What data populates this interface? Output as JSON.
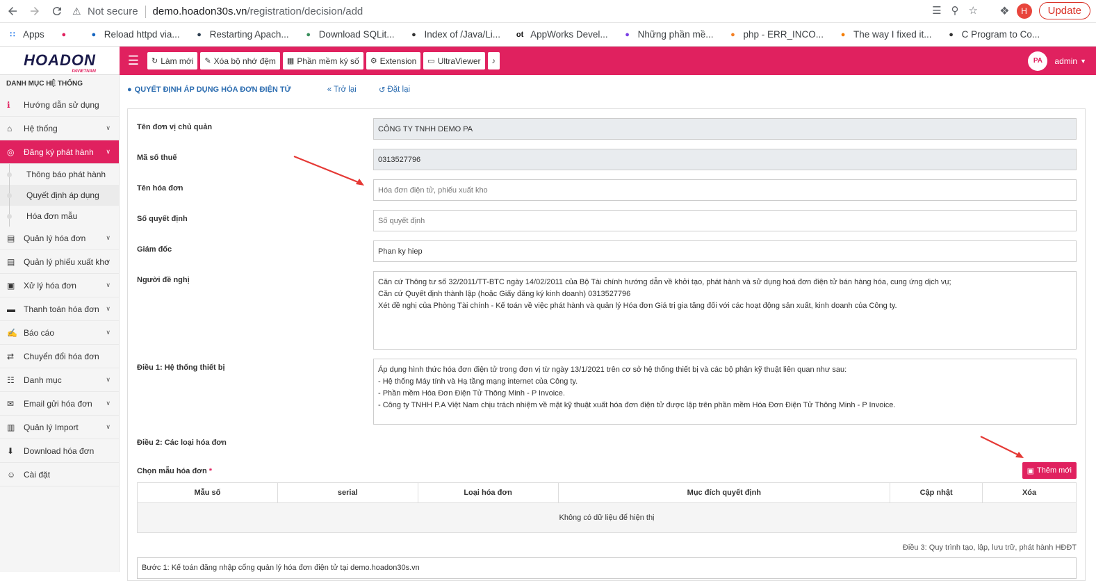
{
  "browser": {
    "not_secure": "Not secure",
    "url_domain": "demo.hoadon30s.vn",
    "url_path": "/registration/decision/add",
    "profile_initial": "H",
    "update_label": "Update"
  },
  "bookmarks": [
    {
      "label": "Apps",
      "icon": "apps-grid-icon",
      "color": "#1a73e8"
    },
    {
      "label": "",
      "icon": "helicopter-icon",
      "color": "#e0215f"
    },
    {
      "label": "Reload httpd via...",
      "icon": "person-icon",
      "color": "#1565c0"
    },
    {
      "label": "Restarting Apach...",
      "icon": "site-icon",
      "color": "#2c3e50"
    },
    {
      "label": "Download SQLit...",
      "icon": "sqlite-icon",
      "color": "#3a8f5c"
    },
    {
      "label": "Index of /Java/Li...",
      "icon": "globe-icon",
      "color": "#333"
    },
    {
      "label": "AppWorks Devel...",
      "icon": "ot-icon",
      "color": "#111"
    },
    {
      "label": "Những phần mề...",
      "icon": "note-icon",
      "color": "#7b3fe4"
    },
    {
      "label": "php - ERR_INCO...",
      "icon": "stackoverflow-icon",
      "color": "#f48024"
    },
    {
      "label": "The way I fixed it...",
      "icon": "blogger-icon",
      "color": "#f57d00"
    },
    {
      "label": "C Program to Co...",
      "icon": "circle-icon",
      "color": "#333"
    }
  ],
  "header": {
    "logo": "HOADON",
    "logo_sub": "PAVIETNAM",
    "buttons": [
      {
        "label": "Làm mới",
        "icon": "refresh-icon"
      },
      {
        "label": "Xóa bộ nhớ đệm",
        "icon": "brush-icon"
      },
      {
        "label": "Phần mềm ký số",
        "icon": "grid-icon"
      },
      {
        "label": "Extension",
        "icon": "extension-icon"
      },
      {
        "label": "UltraViewer",
        "icon": "monitor-icon"
      },
      {
        "label": "",
        "icon": "bell-icon"
      }
    ],
    "user": "admin"
  },
  "sidebar": {
    "title": "DANH MỤC HỆ THỐNG",
    "items": [
      {
        "label": "Hướng dẫn sử dụng",
        "icon": "info-icon",
        "chevron": false
      },
      {
        "label": "Hệ thống",
        "icon": "home-icon",
        "chevron": true
      },
      {
        "label": "Đăng ký phát hành",
        "icon": "globe-icon",
        "chevron": true,
        "active": true
      },
      {
        "label": "Quản lý hóa đơn",
        "icon": "file-icon",
        "chevron": true
      },
      {
        "label": "Quản lý phiếu xuất kho",
        "icon": "file-icon",
        "chevron": true
      },
      {
        "label": "Xử lý hóa đơn",
        "icon": "save-icon",
        "chevron": true
      },
      {
        "label": "Thanh toán hóa đơn",
        "icon": "card-icon",
        "chevron": true
      },
      {
        "label": "Báo cáo",
        "icon": "edit-icon",
        "chevron": true
      },
      {
        "label": "Chuyển đổi hóa đơn",
        "icon": "exchange-icon",
        "chevron": false
      },
      {
        "label": "Danh mục",
        "icon": "sitemap-icon",
        "chevron": true
      },
      {
        "label": "Email gửi hóa đơn",
        "icon": "envelope-icon",
        "chevron": true
      },
      {
        "label": "Quản lý Import",
        "icon": "archive-icon",
        "chevron": true
      },
      {
        "label": "Download hóa đơn",
        "icon": "download-icon",
        "chevron": false
      },
      {
        "label": "Cài đặt",
        "icon": "user-cog-icon",
        "chevron": false
      }
    ],
    "subitems": [
      "Thông báo phát hành",
      "Quyết định áp dụng",
      "Hóa đơn mẫu"
    ]
  },
  "page": {
    "title": "QUYẾT ĐỊNH ÁP DỤNG HÓA ĐƠN ĐIỆN TỬ",
    "back": "Trở lại",
    "reset": "Đặt lại"
  },
  "form": {
    "unit_label": "Tên đơn vị chủ quản",
    "unit_value": "CÔNG TY TNHH DEMO PA",
    "tax_label": "Mã số thuế",
    "tax_value": "0313527796",
    "invoice_name_label": "Tên hóa đơn",
    "invoice_name_placeholder": "Hóa đơn điện tử, phiếu xuất kho",
    "decision_no_label": "Số quyết định",
    "decision_no_placeholder": "Số quyết định",
    "director_label": "Giám đốc",
    "director_value": "Phan ky hiep",
    "proposer_label": "Người đề nghị",
    "proposer_lines": [
      "Căn cứ Thông tư số 32/2011/TT-BTC ngày 14/02/2011 của Bộ Tài chính hướng dẫn về khởi tạo, phát hành và sử dụng hoá đơn điện tử bán hàng hóa, cung ứng dịch vụ;",
      "Căn cứ Quyết định thành lập (hoặc Giấy đăng ký kinh doanh) 0313527796",
      "Xét đề nghị của Phòng Tài chính - Kế toán về việc phát hành và quản lý Hóa đơn Giá trị gia tăng đối với các hoạt động sản xuất, kinh doanh của Công ty."
    ],
    "article1_label": "Điều 1: Hệ thống thiết bị",
    "article1_lines": [
      "Áp dụng hình thức hóa đơn điện tử trong đơn vị từ ngày 13/1/2021 trên cơ sở hệ thống thiết bị và các bộ phận kỹ thuật liên quan như sau:",
      "- Hệ thống Máy tính và Hạ tầng mạng internet của Công ty.",
      "- Phần mềm Hóa Đơn Điện Tử Thông Minh - P Invoice.",
      "- Công ty TNHH P.A Việt Nam chịu trách nhiệm về mặt kỹ thuật xuất hóa đơn điện tử được lập trên phần mềm Hóa Đơn Điện Tử Thông Minh - P Invoice."
    ],
    "article2_label": "Điều 2: Các loại hóa đơn",
    "template_label": "Chọn mẫu hóa đơn",
    "required_mark": "*",
    "add_button": "Thêm mới",
    "table_headers": [
      "Mẫu số",
      "serial",
      "Loại hóa đơn",
      "Mục đích quyết định",
      "Cập nhật",
      "Xóa"
    ],
    "empty_text": "Không có dữ liệu để hiện thị",
    "article3_note": "Điều 3: Quy trình tạo, lập, lưu trữ, phát hành HĐĐT",
    "step1_text": "Bước 1: Kế toán đăng nhập cổng quản lý hóa đơn điện tử tại demo.hoadon30s.vn"
  }
}
